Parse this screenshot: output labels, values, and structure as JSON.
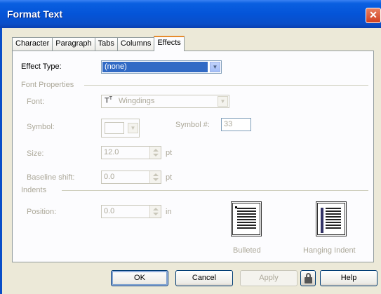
{
  "window": {
    "title": "Format Text",
    "close_glyph": "✕"
  },
  "tabs": [
    {
      "label": "Character",
      "active": false
    },
    {
      "label": "Paragraph",
      "active": false
    },
    {
      "label": "Tabs",
      "active": false
    },
    {
      "label": "Columns",
      "active": false
    },
    {
      "label": "Effects",
      "active": true
    }
  ],
  "effect_type": {
    "label": "Effect Type:",
    "value": "(none)"
  },
  "font_properties": {
    "group_label": "Font Properties",
    "font_label": "Font:",
    "font_value": "Wingdings",
    "symbol_label": "Symbol:",
    "symbol_num_label": "Symbol #:",
    "symbol_num_value": "33",
    "size_label": "Size:",
    "size_value": "12.0",
    "size_unit": "pt",
    "baseline_label": "Baseline shift:",
    "baseline_value": "0.0",
    "baseline_unit": "pt"
  },
  "indents": {
    "group_label": "Indents",
    "position_label": "Position:",
    "position_value": "0.0",
    "position_unit": "in",
    "bulleted_label": "Bulleted",
    "hanging_label": "Hanging Indent"
  },
  "buttons": {
    "ok": "OK",
    "cancel": "Cancel",
    "apply": "Apply",
    "help": "Help"
  },
  "icons": [
    "close-icon",
    "dropdown-arrow-icon",
    "truetype-font-icon",
    "spinner-icon",
    "lock-icon",
    "bulleted-style-icon",
    "hanging-indent-icon"
  ]
}
